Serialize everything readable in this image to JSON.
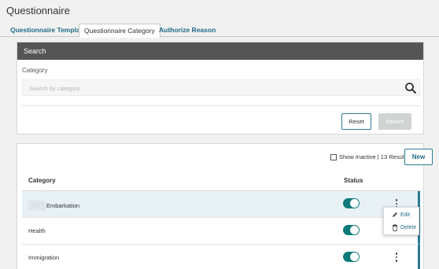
{
  "page": {
    "title": "Questionnaire"
  },
  "tabs": [
    {
      "label": "Questionnaire Template"
    },
    {
      "label": "Questionnaire Category",
      "active": true
    },
    {
      "label": "Authorize Reason"
    }
  ],
  "search": {
    "header": "Search",
    "category_label": "Category",
    "placeholder": "Search by category",
    "value": "",
    "reset_label": "Reset",
    "search_label": "Search"
  },
  "results": {
    "show_inactive_label": "Show Inactive | 13 Results",
    "new_label": "New",
    "columns": {
      "category": "Category",
      "status": "Status"
    },
    "rows": [
      {
        "category": "Embarkation",
        "status_active": true
      },
      {
        "category": "Health",
        "status_active": true
      },
      {
        "category": "Immigration",
        "status_active": true
      }
    ]
  },
  "context_menu": {
    "edit": "Edit",
    "delete": "Delete"
  },
  "colors": {
    "accent": "#1f6c86",
    "toggle_on": "#0d7a7a",
    "header_bg": "#555555"
  },
  "icons": [
    "search-icon",
    "kebab-icon",
    "pencil-icon",
    "trash-icon"
  ]
}
